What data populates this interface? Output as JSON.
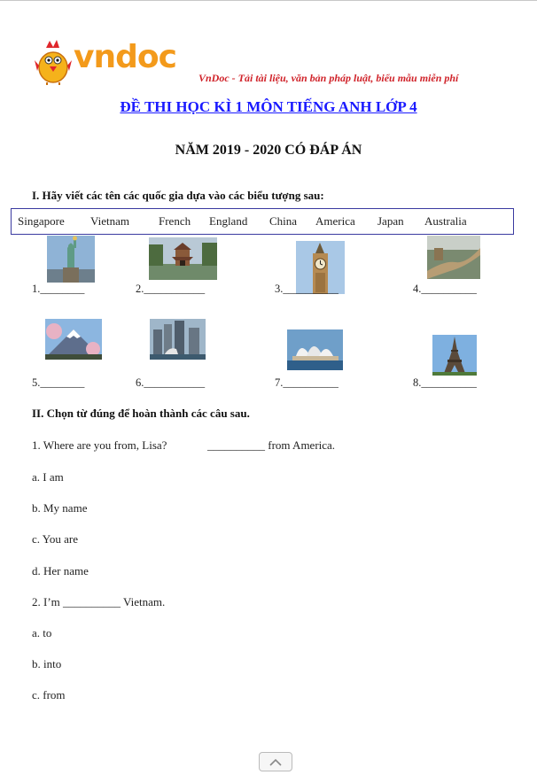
{
  "header": {
    "logo_text": "vndoc",
    "tagline": "VnDoc - Tải tài liệu, văn bản pháp luật, biểu mẫu miễn phí"
  },
  "title": {
    "line1": "ĐỀ THI HỌC KÌ 1 MÔN TIẾNG ANH LỚP 4",
    "line2": "NĂM 2019 - 2020 CÓ ĐÁP ÁN"
  },
  "section1": {
    "heading": "I. Hãy viết các tên các quốc gia dựa vào các biểu tượng sau:",
    "words": [
      "Singapore",
      "Vietnam",
      "French",
      "England",
      "China",
      "America",
      "Japan",
      "Australia"
    ],
    "blanks": [
      "1.________",
      "2.___________",
      "3.__________",
      "4.__________",
      "5.________",
      "6.___________",
      "7.__________",
      "8.__________"
    ],
    "pictures": [
      "statue-of-liberty",
      "one-pillar-pagoda",
      "big-ben",
      "great-wall",
      "mount-fuji",
      "merlion",
      "sydney-opera-house",
      "eiffel-tower"
    ]
  },
  "section2": {
    "heading": "II. Chọn từ đúng để hoàn thành các câu sau.",
    "q1": {
      "text": "1. Where are you from, Lisa?",
      "answer": "__________ from America.",
      "options": [
        "a. I am",
        "b. My name",
        "c. You are",
        "d. Her name"
      ]
    },
    "q2": {
      "text": "2. I’m __________ Vietnam.",
      "options": [
        "a. to",
        "b. into",
        "c. from"
      ]
    }
  },
  "colors": {
    "brand_orange": "#f39a1b",
    "tagline_red": "#d0232a",
    "title_blue": "#1a1aff",
    "box_border": "#3a3aa0"
  }
}
